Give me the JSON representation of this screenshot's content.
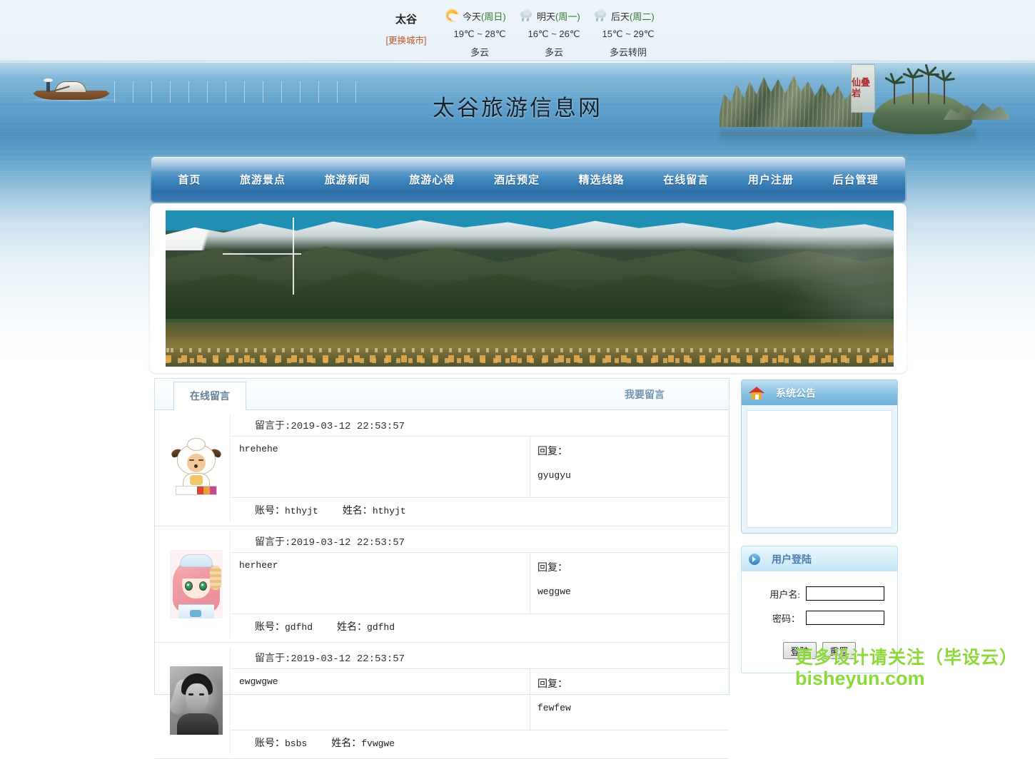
{
  "weather": {
    "city": "太谷",
    "change_city": "[更换城市]",
    "days": [
      {
        "icon": "sun-cloud-icon",
        "label_prefix": "今天",
        "label_dow": "(周日)",
        "temp": "19℃ ~ 28℃",
        "desc": "多云"
      },
      {
        "icon": "cloud-icon",
        "label_prefix": "明天",
        "label_dow": "(周一)",
        "temp": "16℃ ~ 26℃",
        "desc": "多云"
      },
      {
        "icon": "cloud-icon",
        "label_prefix": "后天",
        "label_dow": "(周二)",
        "temp": "15℃ ~ 29℃",
        "desc": "多云转阴"
      }
    ]
  },
  "header": {
    "site_title": "太谷旅游信息网",
    "signboard_text": "仙叠岩"
  },
  "nav": {
    "items": [
      {
        "label": "首页"
      },
      {
        "label": "旅游景点"
      },
      {
        "label": "旅游新闻"
      },
      {
        "label": "旅游心得"
      },
      {
        "label": "酒店预定"
      },
      {
        "label": "精选线路"
      },
      {
        "label": "在线留言"
      },
      {
        "label": "用户注册"
      },
      {
        "label": "后台管理"
      }
    ]
  },
  "main": {
    "tab_label": "在线留言",
    "post_link": "我要留言",
    "labels": {
      "date_prefix": "留言于:",
      "reply": "回复：",
      "account": "账号：",
      "name": "姓名："
    },
    "messages": [
      {
        "avatar": "sheep-avatar",
        "date": "2019-03-12 22:53:57",
        "content": "hrehehe",
        "reply": "gyugyu",
        "account": "hthyjt",
        "name": "hthyjt"
      },
      {
        "avatar": "anime-avatar",
        "date": "2019-03-12 22:53:57",
        "content": "herheer",
        "reply": "weggwe",
        "account": "gdfhd",
        "name": "gdfhd"
      },
      {
        "avatar": "photo-avatar",
        "date": "2019-03-12 22:53:57",
        "content": "ewgwgwe",
        "reply": "fewfew",
        "account": "bsbs",
        "name": "fvwgwe"
      }
    ]
  },
  "sidebar": {
    "notice": {
      "icon": "home-icon",
      "title": "系统公告",
      "body": ""
    },
    "login": {
      "icon": "arrow-circle-icon",
      "title": "用户登陆",
      "username_label": "用户名:",
      "username_value": "",
      "password_label": "密码：",
      "password_value": "",
      "submit_label": "登陆",
      "reset_label": "重置"
    }
  },
  "watermark": {
    "line1": "更多设计请关注（毕设云）",
    "line2": "bisheyun.com",
    "color": "#8bd93a"
  },
  "colors": {
    "nav_blue": "#3d86bd",
    "panel_blue": "#6fb2da",
    "link_blue": "#7394ae",
    "city_link": "#c0522a"
  }
}
